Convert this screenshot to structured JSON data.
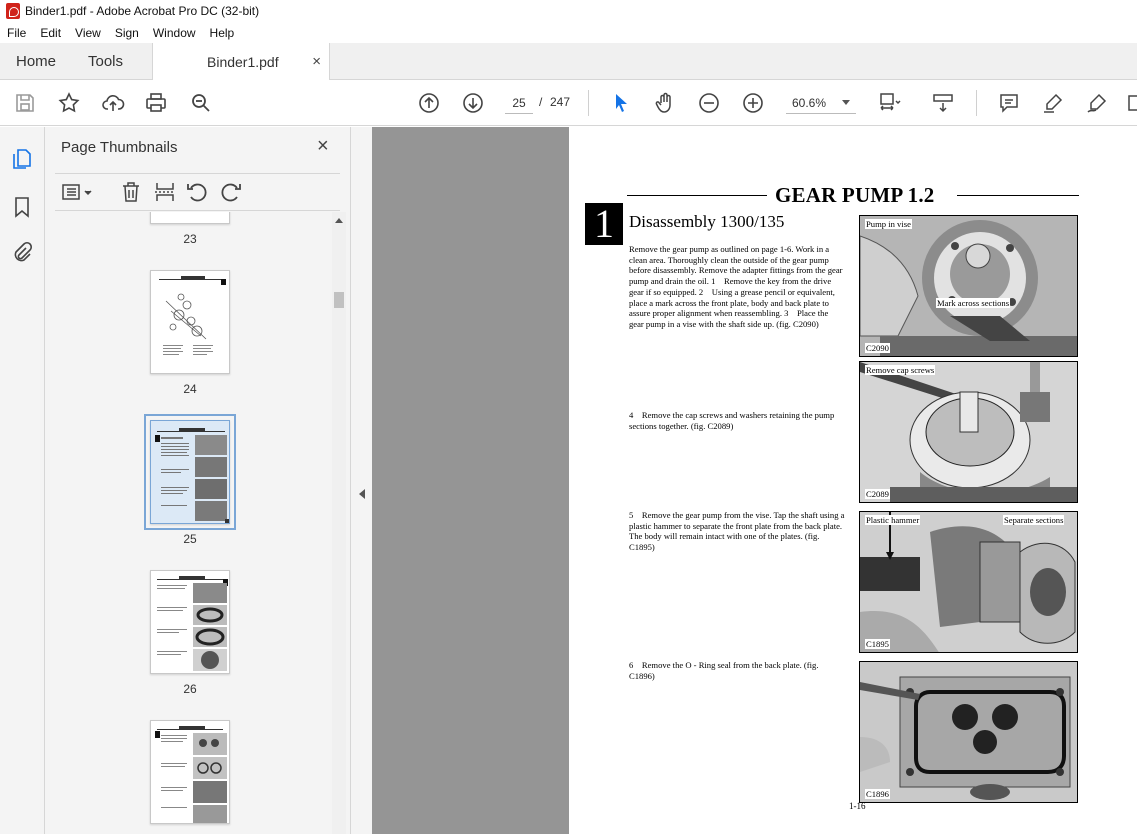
{
  "window": {
    "title": "Binder1.pdf - Adobe Acrobat Pro DC (32-bit)"
  },
  "menu": [
    "File",
    "Edit",
    "View",
    "Sign",
    "Window",
    "Help"
  ],
  "tabs": {
    "home": "Home",
    "tools": "Tools",
    "document": "Binder1.pdf",
    "close": "×"
  },
  "toolbar": {
    "current_page": "25",
    "page_separator": "/",
    "total_pages": "247",
    "zoom": "60.6%"
  },
  "colors": {
    "accent_blue": "#1473e6",
    "select_outline": "#7aa6d6",
    "doc_background": "#959595"
  },
  "thumbnails": {
    "title": "Page Thumbnails",
    "close": "×",
    "pages": [
      {
        "label": "23"
      },
      {
        "label": "24"
      },
      {
        "label": "25",
        "selected": true
      },
      {
        "label": "26"
      },
      {
        "label": ""
      }
    ]
  },
  "page": {
    "heading": "GEAR PUMP  1.2",
    "section_number": "1",
    "subtitle": "Disassembly 1300/135",
    "paragraphs": [
      "Remove the gear pump as outlined on page 1-6. Work in a clean area. Thoroughly clean the outside of the gear pump before disassembly. Remove the adapter fittings from the gear pump and drain the oil. 1 Remove the key from the drive gear if so equipped. 2 Using a grease pencil or equivalent, place a mark across the front plate, body and back plate to assure proper alignment when reassembling. 3 Place the gear pump in a vise with the shaft side up. (fig. C2090)",
      "4 Remove the cap screws and washers retaining the pump sections together. (fig. C2089)",
      "5 Remove the gear pump from the vise. Tap the shaft using a plastic hammer to separate the front plate from the back plate. The body will remain intact with one of the plates. (fig. C1895)",
      "6 Remove the O - Ring seal from the back plate. (fig. C1896)"
    ],
    "figures": [
      {
        "labels": [
          "Pump in vise",
          "Mark across sections"
        ],
        "code": "C2090"
      },
      {
        "labels": [
          "Remove cap screws"
        ],
        "code": "C2089"
      },
      {
        "labels": [
          "Plastic hammer",
          "Separate sections"
        ],
        "code": "C1895"
      },
      {
        "labels": [],
        "code": "C1896"
      }
    ],
    "page_number": "1-16"
  }
}
